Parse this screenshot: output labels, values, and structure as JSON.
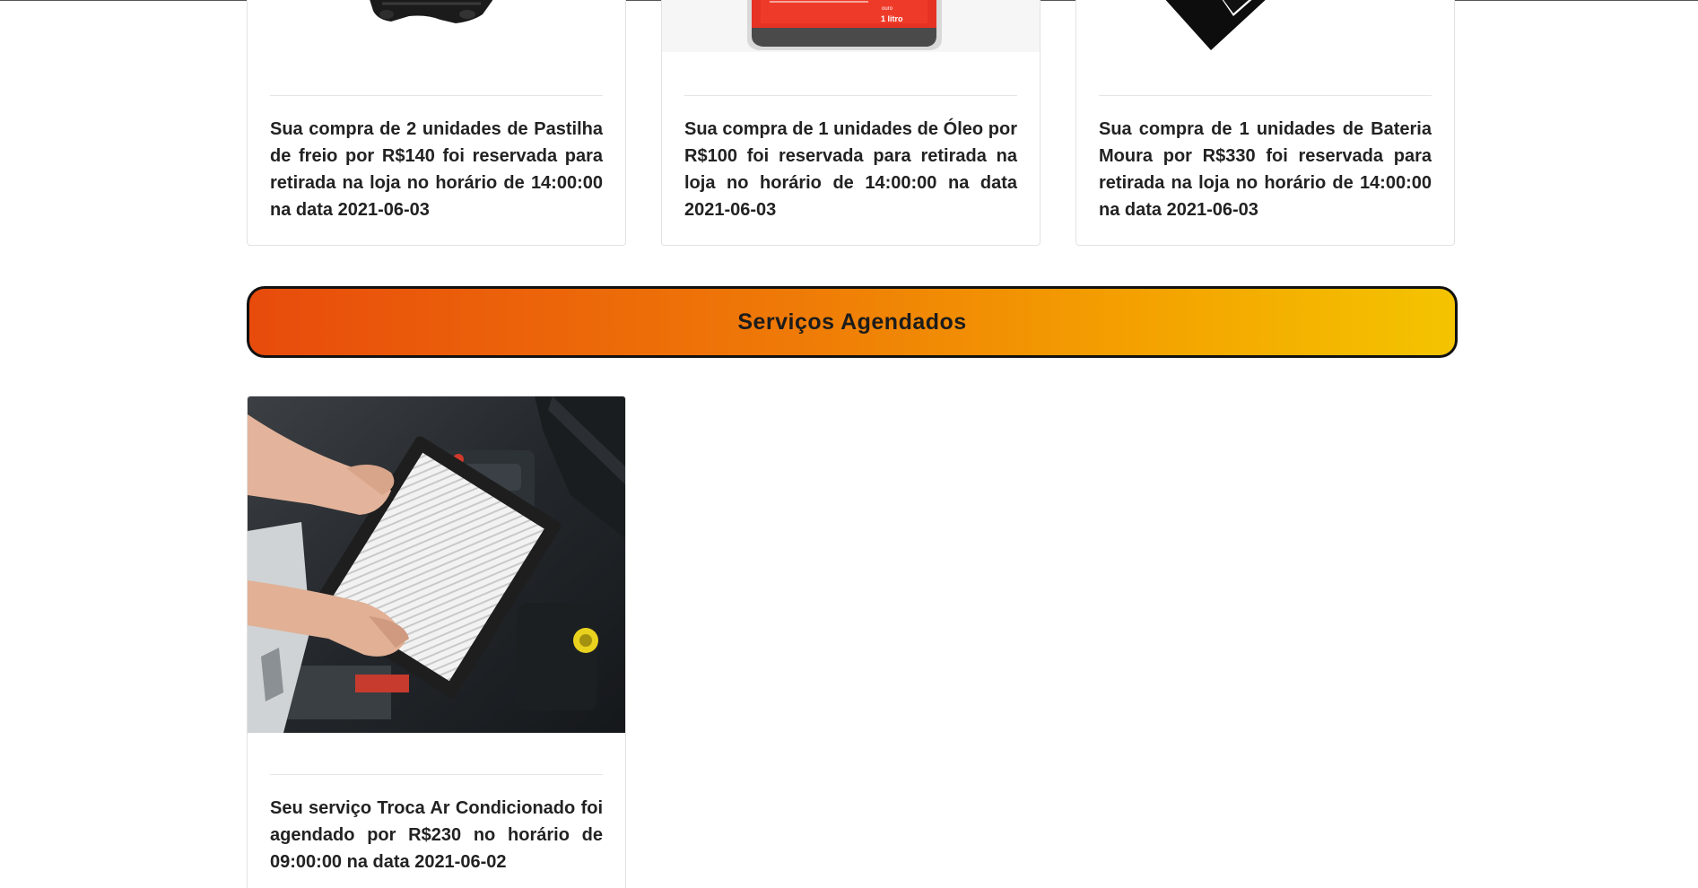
{
  "products": [
    {
      "icon": "brake-pad-product-image",
      "text": "Sua compra de 2 unidades de Pastilha de freio por R$140 foi reservada para retirada na loja no horário de 14:00:00 na data 2021-06-03"
    },
    {
      "icon": "oil-bottle-product-image",
      "label": "1 litro",
      "text": "Sua compra de 1 unidades de Óleo por R$100 foi reservada para retirada na loja no horário de 14:00:00 na data 2021-06-03"
    },
    {
      "icon": "battery-product-image",
      "text": "Sua compra de 1 unidades de Bateria Moura por R$330 foi reservada para retirada na loja no horário de 14:00:00 na data 2021-06-03"
    }
  ],
  "services_section": {
    "title": "Serviços Agendados"
  },
  "services": [
    {
      "icon": "air-filter-service-image",
      "text": "Seu serviço Troca Ar Condicionado foi agendado por R$230 no horário de 09:00:00 na data 2021-06-02"
    }
  ],
  "colors": {
    "banner_start": "#e84b0c",
    "banner_end": "#f4c400",
    "text": "#222222",
    "card_border": "#e2e2e2"
  }
}
